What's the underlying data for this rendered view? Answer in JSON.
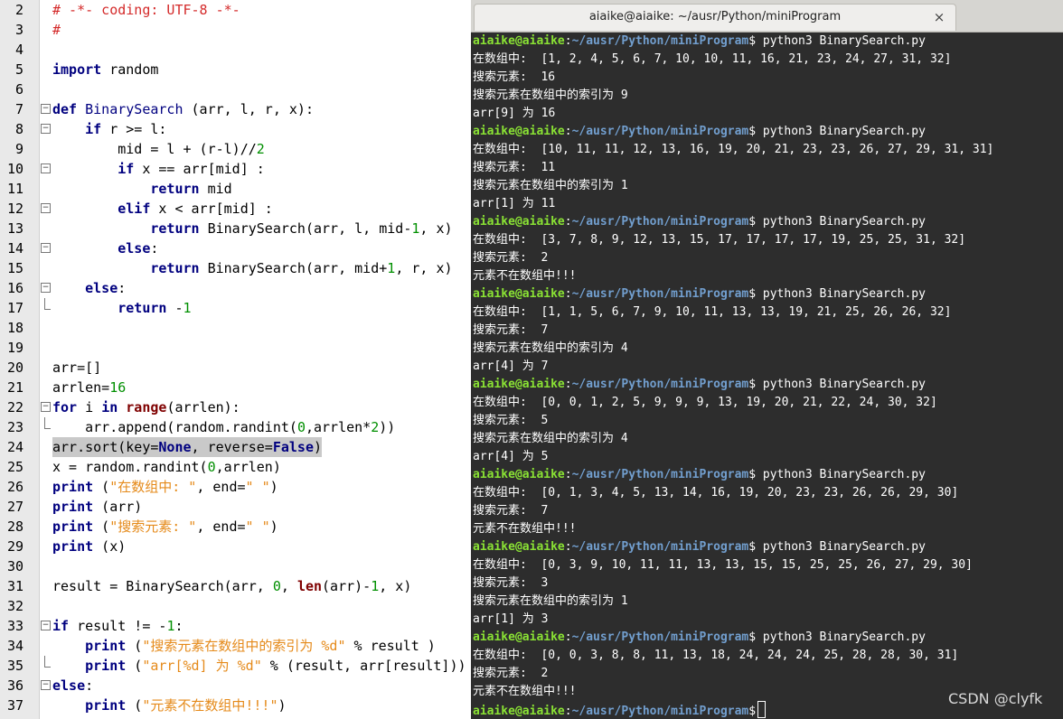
{
  "editor": {
    "line_numbers": [
      "2",
      "3",
      "4",
      "5",
      "6",
      "7",
      "8",
      "9",
      "10",
      "11",
      "12",
      "13",
      "14",
      "15",
      "16",
      "17",
      "18",
      "19",
      "20",
      "21",
      "22",
      "23",
      "24",
      "25",
      "26",
      "27",
      "28",
      "29",
      "30",
      "31",
      "32",
      "33",
      "34",
      "35",
      "36",
      "37"
    ],
    "lines": [
      [
        [
          "c",
          "# -*- coding: UTF-8 -*-"
        ]
      ],
      [
        [
          "c",
          "#"
        ]
      ],
      [],
      [
        [
          "k",
          "import"
        ],
        [
          "p",
          " random"
        ]
      ],
      [],
      [
        [
          "k",
          "def"
        ],
        [
          "p",
          " "
        ],
        [
          "d",
          "BinarySearch"
        ],
        [
          "p",
          " (arr, l, r, x):"
        ]
      ],
      [
        [
          "p",
          "    "
        ],
        [
          "k",
          "if"
        ],
        [
          "p",
          " r >= l:"
        ]
      ],
      [
        [
          "p",
          "        mid = l + (r-l)//"
        ],
        [
          "n",
          "2"
        ]
      ],
      [
        [
          "p",
          "        "
        ],
        [
          "k",
          "if"
        ],
        [
          "p",
          " x == arr[mid] :"
        ]
      ],
      [
        [
          "p",
          "            "
        ],
        [
          "k",
          "return"
        ],
        [
          "p",
          " mid"
        ]
      ],
      [
        [
          "p",
          "        "
        ],
        [
          "k",
          "elif"
        ],
        [
          "p",
          " x < arr[mid] :"
        ]
      ],
      [
        [
          "p",
          "            "
        ],
        [
          "k",
          "return"
        ],
        [
          "p",
          " BinarySearch(arr, l, mid-"
        ],
        [
          "n",
          "1"
        ],
        [
          "p",
          ", x)"
        ]
      ],
      [
        [
          "p",
          "        "
        ],
        [
          "k",
          "else"
        ],
        [
          "p",
          ":"
        ]
      ],
      [
        [
          "p",
          "            "
        ],
        [
          "k",
          "return"
        ],
        [
          "p",
          " BinarySearch(arr, mid+"
        ],
        [
          "n",
          "1"
        ],
        [
          "p",
          ", r, x)"
        ]
      ],
      [
        [
          "p",
          "    "
        ],
        [
          "k",
          "else"
        ],
        [
          "p",
          ":"
        ]
      ],
      [
        [
          "p",
          "        "
        ],
        [
          "k",
          "return"
        ],
        [
          "p",
          " -"
        ],
        [
          "n",
          "1"
        ]
      ],
      [],
      [],
      [
        [
          "p",
          "arr=[]"
        ]
      ],
      [
        [
          "p",
          "arrlen="
        ],
        [
          "n",
          "16"
        ]
      ],
      [
        [
          "k",
          "for"
        ],
        [
          "p",
          " i "
        ],
        [
          "k",
          "in"
        ],
        [
          "p",
          " "
        ],
        [
          "bi",
          "range"
        ],
        [
          "p",
          "(arrlen):"
        ]
      ],
      [
        [
          "p",
          "    arr.append(random.randint("
        ],
        [
          "n",
          "0"
        ],
        [
          "p",
          ",arrlen*"
        ],
        [
          "n",
          "2"
        ],
        [
          "p",
          "))"
        ]
      ],
      [
        [
          "p",
          "arr.sort(key="
        ],
        [
          "k",
          "None"
        ],
        [
          "p",
          ", reverse="
        ],
        [
          "k",
          "False"
        ],
        [
          "p",
          ")"
        ]
      ],
      [
        [
          "p",
          "x = random.randint("
        ],
        [
          "n",
          "0"
        ],
        [
          "p",
          ",arrlen)"
        ]
      ],
      [
        [
          "k",
          "print"
        ],
        [
          "p",
          " ("
        ],
        [
          "s",
          "\"在数组中: \""
        ],
        [
          "p",
          ", end="
        ],
        [
          "s",
          "\" \""
        ],
        [
          "p",
          ")"
        ]
      ],
      [
        [
          "k",
          "print"
        ],
        [
          "p",
          " (arr)"
        ]
      ],
      [
        [
          "k",
          "print"
        ],
        [
          "p",
          " ("
        ],
        [
          "s",
          "\"搜索元素: \""
        ],
        [
          "p",
          ", end="
        ],
        [
          "s",
          "\" \""
        ],
        [
          "p",
          ")"
        ]
      ],
      [
        [
          "k",
          "print"
        ],
        [
          "p",
          " (x)"
        ]
      ],
      [],
      [
        [
          "p",
          "result = BinarySearch(arr, "
        ],
        [
          "n",
          "0"
        ],
        [
          "p",
          ", "
        ],
        [
          "bi",
          "len"
        ],
        [
          "p",
          "(arr)-"
        ],
        [
          "n",
          "1"
        ],
        [
          "p",
          ", x)"
        ]
      ],
      [],
      [
        [
          "k",
          "if"
        ],
        [
          "p",
          " result != -"
        ],
        [
          "n",
          "1"
        ],
        [
          "p",
          ":"
        ]
      ],
      [
        [
          "p",
          "    "
        ],
        [
          "k",
          "print"
        ],
        [
          "p",
          " ("
        ],
        [
          "s",
          "\"搜索元素在数组中的索引为 %d\""
        ],
        [
          "p",
          " % result )"
        ]
      ],
      [
        [
          "p",
          "    "
        ],
        [
          "k",
          "print"
        ],
        [
          "p",
          " ("
        ],
        [
          "s",
          "\"arr[%d] 为 %d\""
        ],
        [
          "p",
          " % (result, arr[result]))"
        ]
      ],
      [
        [
          "k",
          "else"
        ],
        [
          "p",
          ":"
        ]
      ],
      [
        [
          "p",
          "    "
        ],
        [
          "k",
          "print"
        ],
        [
          "p",
          " ("
        ],
        [
          "s",
          "\"元素不在数组中!!!\""
        ],
        [
          "p",
          ")"
        ]
      ]
    ],
    "fold_markers": {
      "7": "minus",
      "8": "minus",
      "10": "minus",
      "12": "minus",
      "14": "minus",
      "16": "minus",
      "17": "end",
      "22": "minus",
      "23": "end",
      "33": "minus",
      "35": "end",
      "36": "minus"
    },
    "highlighted_line": "24"
  },
  "terminal": {
    "title": "aiaike@aiaike: ~/ausr/Python/miniProgram",
    "close_glyph": "×",
    "prompt_user": "aiaike@aiaike",
    "prompt_sep": ":",
    "prompt_path": "~/ausr/Python/miniProgram",
    "prompt_end": "$",
    "command": " python3 BinarySearch.py",
    "lines": [
      {
        "type": "prompt"
      },
      {
        "type": "out",
        "text": "在数组中:  [1, 2, 4, 5, 6, 7, 10, 10, 11, 16, 21, 23, 24, 27, 31, 32]"
      },
      {
        "type": "out",
        "text": "搜索元素:  16"
      },
      {
        "type": "out",
        "text": "搜索元素在数组中的索引为 9"
      },
      {
        "type": "out",
        "text": "arr[9] 为 16"
      },
      {
        "type": "prompt"
      },
      {
        "type": "out",
        "text": "在数组中:  [10, 11, 11, 12, 13, 16, 19, 20, 21, 23, 23, 26, 27, 29, 31, 31]"
      },
      {
        "type": "out",
        "text": "搜索元素:  11"
      },
      {
        "type": "out",
        "text": "搜索元素在数组中的索引为 1"
      },
      {
        "type": "out",
        "text": "arr[1] 为 11"
      },
      {
        "type": "prompt"
      },
      {
        "type": "out",
        "text": "在数组中:  [3, 7, 8, 9, 12, 13, 15, 17, 17, 17, 17, 19, 25, 25, 31, 32]"
      },
      {
        "type": "out",
        "text": "搜索元素:  2"
      },
      {
        "type": "out",
        "text": "元素不在数组中!!!"
      },
      {
        "type": "prompt"
      },
      {
        "type": "out",
        "text": "在数组中:  [1, 1, 5, 6, 7, 9, 10, 11, 13, 13, 19, 21, 25, 26, 26, 32]"
      },
      {
        "type": "out",
        "text": "搜索元素:  7"
      },
      {
        "type": "out",
        "text": "搜索元素在数组中的索引为 4"
      },
      {
        "type": "out",
        "text": "arr[4] 为 7"
      },
      {
        "type": "prompt"
      },
      {
        "type": "out",
        "text": "在数组中:  [0, 0, 1, 2, 5, 9, 9, 9, 13, 19, 20, 21, 22, 24, 30, 32]"
      },
      {
        "type": "out",
        "text": "搜索元素:  5"
      },
      {
        "type": "out",
        "text": "搜索元素在数组中的索引为 4"
      },
      {
        "type": "out",
        "text": "arr[4] 为 5"
      },
      {
        "type": "prompt"
      },
      {
        "type": "out",
        "text": "在数组中:  [0, 1, 3, 4, 5, 13, 14, 16, 19, 20, 23, 23, 26, 26, 29, 30]"
      },
      {
        "type": "out",
        "text": "搜索元素:  7"
      },
      {
        "type": "out",
        "text": "元素不在数组中!!!"
      },
      {
        "type": "prompt"
      },
      {
        "type": "out",
        "text": "在数组中:  [0, 3, 9, 10, 11, 11, 13, 13, 15, 15, 25, 25, 26, 27, 29, 30]"
      },
      {
        "type": "out",
        "text": "搜索元素:  3"
      },
      {
        "type": "out",
        "text": "搜索元素在数组中的索引为 1"
      },
      {
        "type": "out",
        "text": "arr[1] 为 3"
      },
      {
        "type": "prompt"
      },
      {
        "type": "out",
        "text": "在数组中:  [0, 0, 3, 8, 8, 11, 13, 18, 24, 24, 24, 25, 28, 28, 30, 31]"
      },
      {
        "type": "out",
        "text": "搜索元素:  2"
      },
      {
        "type": "out",
        "text": "元素不在数组中!!!"
      },
      {
        "type": "prompt_active"
      }
    ]
  },
  "watermark": "CSDN @clyfk",
  "colors": {
    "editor_bg": "#ffffff",
    "gutter_bg": "#e9e9e9",
    "keyword": "#00007f",
    "builtin": "#7f0000",
    "number": "#008f00",
    "string": "#e58a1a",
    "comment": "#d42a2a",
    "terminal_bg": "#2d2d2d",
    "prompt_user": "#8ae234",
    "prompt_path": "#729fcf"
  }
}
